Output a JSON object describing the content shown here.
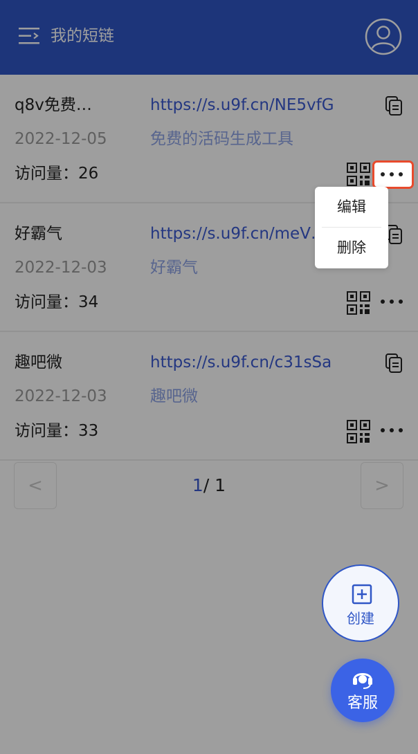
{
  "header": {
    "title": "我的短链",
    "menu_icon": "menu-icon",
    "user_icon": "user-avatar-icon",
    "background_color": "#2f56c6"
  },
  "links": [
    {
      "name": "q8v免费…",
      "url": "https://s.u9f.cn/NE5vfG",
      "date": "2022-12-05",
      "description": "免费的活码生成工具",
      "visits": "访问量：26"
    },
    {
      "name": "好霸气",
      "url": "https://s.u9f.cn/meV…",
      "date": "2022-12-03",
      "description": "好霸气",
      "visits": "访问量：34"
    },
    {
      "name": "趣吧微",
      "url": "https://s.u9f.cn/c31sSa",
      "date": "2022-12-03",
      "description": "趣吧微",
      "visits": "访问量：33"
    }
  ],
  "pagination": {
    "prev": "<",
    "next": ">",
    "current": "1",
    "total": "/ 1"
  },
  "popup_menu": {
    "edit": "编辑",
    "delete": "删除"
  },
  "fab": {
    "create_label": "创建",
    "service_label": "客服"
  },
  "colors": {
    "accent": "#3a5ad0",
    "highlight": "#e84a2c"
  }
}
